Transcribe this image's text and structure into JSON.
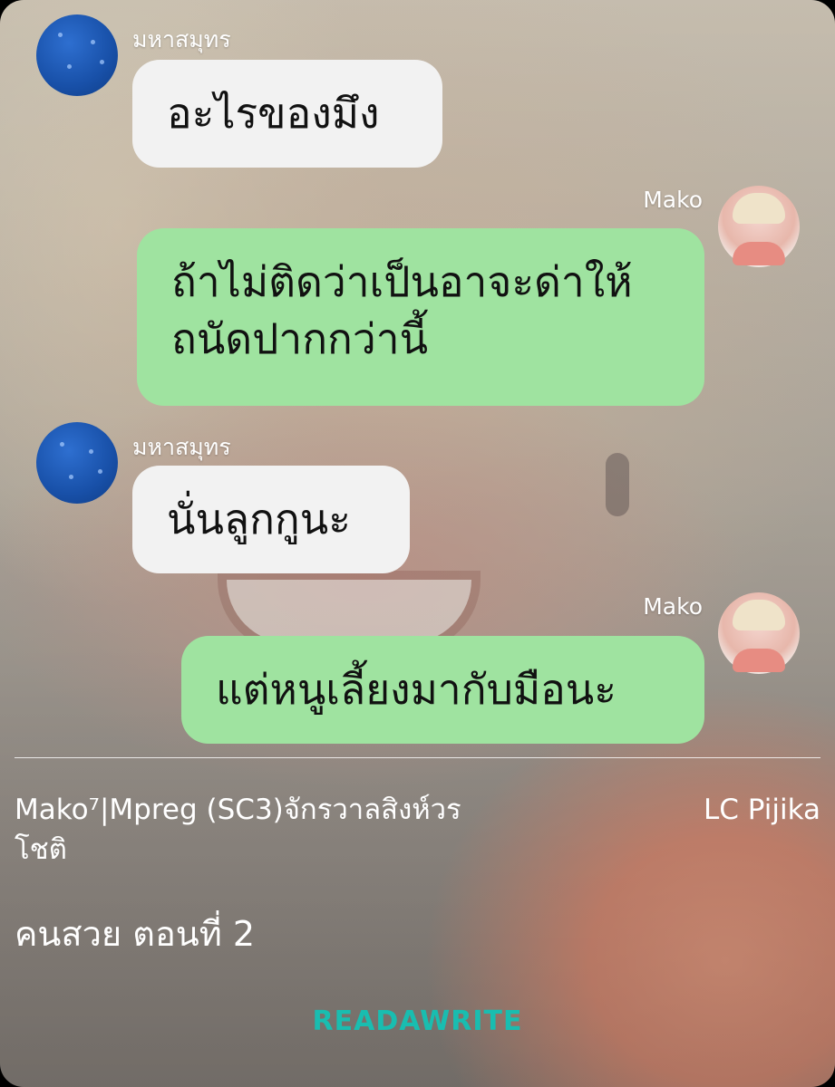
{
  "messages": [
    {
      "sender": "มหาสมุทร",
      "text": "อะไรของมึง",
      "side": "left",
      "avatar": "blue-avatar"
    },
    {
      "sender": "Mako",
      "text": "ถ้าไม่ติดว่าเป็นอาจะด่าให้ถนัดปากกว่านี้",
      "side": "right",
      "avatar": "photo-avatar"
    },
    {
      "sender": "มหาสมุทร",
      "text": "นั่นลูกกูนะ",
      "side": "left",
      "avatar": "blue-avatar"
    },
    {
      "sender": "Mako",
      "text": "แต่หนูเลี้ยงมากับมือนะ",
      "side": "right",
      "avatar": "photo-avatar"
    }
  ],
  "footer": {
    "tags": "Mako⁷|Mpreg (SC3)จักรวาลสิงห์วรโชติ",
    "credit": "LC Pijika",
    "chapter_title": "คนสวย ตอนที่ 2",
    "logo": "READAWRITE"
  },
  "colors": {
    "left_bubble": "#f2f2f2",
    "right_bubble": "#9fe3a0",
    "logo": "#19bdb0",
    "text": "#111111"
  }
}
